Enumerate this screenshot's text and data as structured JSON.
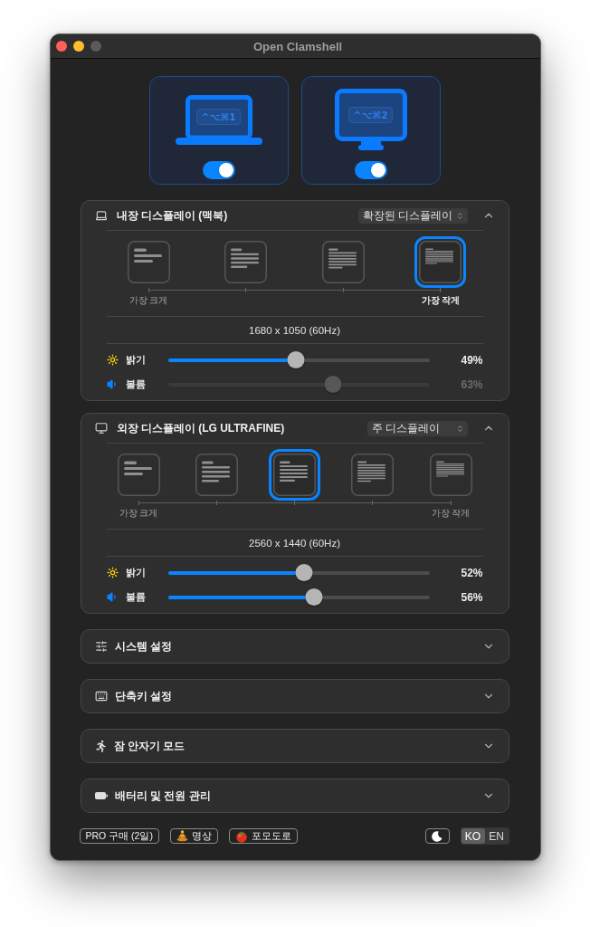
{
  "window": {
    "title": "Open Clamshell",
    "zoom_button": {
      "disabled": true
    }
  },
  "display_cards": [
    {
      "kind": "laptop",
      "shortcut": "^⌥⌘1",
      "on": true
    },
    {
      "kind": "monitor",
      "shortcut": "^⌥⌘2",
      "on": true
    }
  ],
  "display_panels": [
    {
      "kind": "laptop",
      "title": "내장 디스플레이 (맥북)",
      "mode_select": {
        "value": "확장된 디스플레이"
      },
      "expanded": true,
      "scale_options": [
        {
          "selected": false,
          "label": "가장 크게"
        },
        {
          "selected": false
        },
        {
          "selected": false
        },
        {
          "selected": true,
          "label": "가장 작게"
        }
      ],
      "resolution": "1680 x 1050 (60Hz)",
      "sliders": [
        {
          "kind": "brightness",
          "label": "밝기",
          "level": 0.49,
          "reading": "49%",
          "disabled": false
        },
        {
          "kind": "volume",
          "label": "볼륨",
          "level": 0.63,
          "reading": "63%",
          "disabled": true
        }
      ]
    },
    {
      "kind": "monitor",
      "title": "외장 디스플레이 (LG ULTRAFINE)",
      "mode_select": {
        "value": "주 디스플레이"
      },
      "expanded": true,
      "scale_options": [
        {
          "selected": false,
          "label": "가장 크게"
        },
        {
          "selected": false
        },
        {
          "selected": true
        },
        {
          "selected": false
        },
        {
          "selected": false,
          "label": "가장 작게"
        }
      ],
      "resolution": "2560 x 1440 (60Hz)",
      "sliders": [
        {
          "kind": "brightness",
          "label": "밝기",
          "level": 0.52,
          "reading": "52%",
          "disabled": false
        },
        {
          "kind": "volume",
          "label": "볼륨",
          "level": 0.56,
          "reading": "56%",
          "disabled": false
        }
      ]
    }
  ],
  "sections": [
    {
      "title": "시스템 설정",
      "expanded": false
    },
    {
      "title": "단축키 설정",
      "expanded": false
    },
    {
      "title": "잠 안자기 모드",
      "expanded": false
    },
    {
      "title": "배터리 및 전원 관리",
      "expanded": false
    }
  ],
  "footer": {
    "buttons": [
      {
        "label": "PRO 구매 (2일)"
      },
      {
        "label": "명상"
      },
      {
        "label": "포모도로"
      }
    ],
    "languages": [
      {
        "label": "KO",
        "selected": true
      },
      {
        "label": "EN",
        "selected": false
      }
    ]
  }
}
